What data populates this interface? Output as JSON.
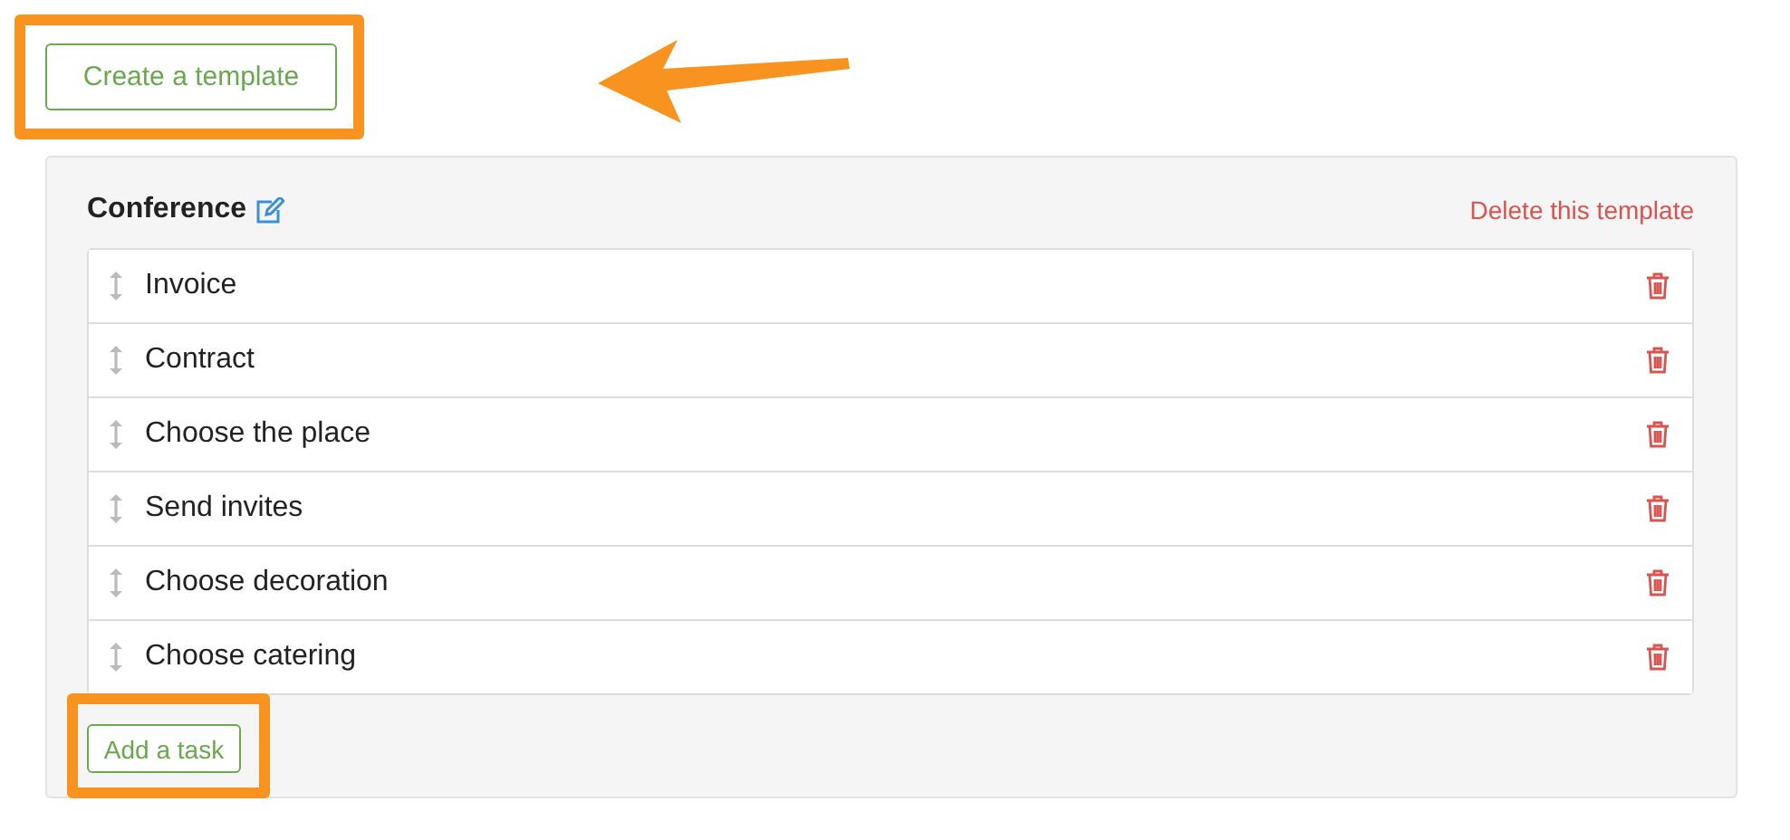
{
  "create_button": {
    "label": "Create a template"
  },
  "template": {
    "title": "Conference",
    "delete_link": "Delete this template",
    "tasks": [
      {
        "label": "Invoice"
      },
      {
        "label": "Contract"
      },
      {
        "label": "Choose the place"
      },
      {
        "label": "Send invites"
      },
      {
        "label": "Choose decoration"
      },
      {
        "label": "Choose catering"
      }
    ],
    "add_button": {
      "label": "Add a task"
    }
  }
}
